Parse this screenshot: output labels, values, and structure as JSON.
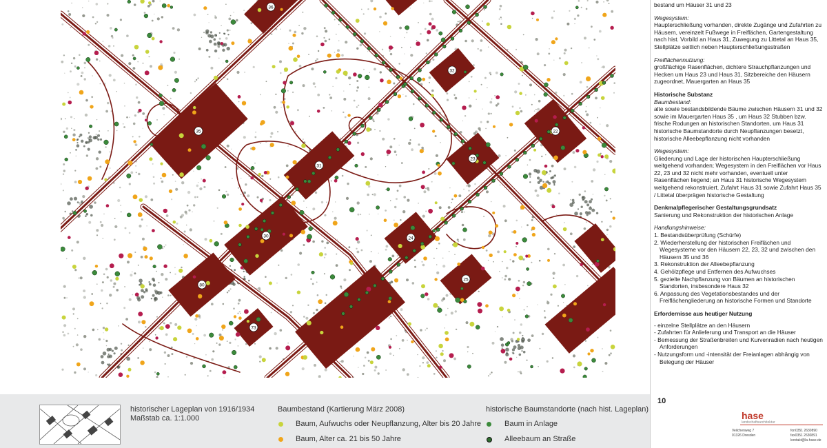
{
  "map": {
    "building_labels": [
      "36",
      "32",
      "35",
      "22",
      "31",
      "23",
      "30",
      "24",
      "80",
      "25",
      "73"
    ],
    "colors": {
      "building": "#7a1a14",
      "road": "#7a1a14",
      "tree_young": "#c8d43c",
      "tree_mid": "#f0a51a",
      "tree_old": "#b51d4e",
      "tree_hist": "#3b8a3b",
      "vegetation": "#7f8378"
    }
  },
  "side": {
    "top_cut": "bestand um Häuser 31 und 23",
    "wege1_title": "Wegesystem:",
    "wege1_text": "Haupterschließung vorhanden, direkte Zugänge und Zufahrten zu Häusern, vereinzelt Fußwege in Freiflächen, Gartengestaltung nach hist. Vorbild an Haus 31, Zuwegung zu Littetal an Haus 35, Stellplätze seitlich neben Haupterschließungsstraßen",
    "frei_title": "Freiflächennutzung:",
    "frei_text": "großflächige Rasenflächen, dichtere Strauchpflanzungen und Hecken um Haus 23 und Haus 31, Sitzbereiche den Häusern zugeordnet, Mauergarten an Haus 35",
    "hist_title": "Historische Substanz",
    "baum_title": "Baumbestand:",
    "baum_text": "alte sowie bestandsbildende Bäume zwischen Häusern 31 und 32 sowie im Mauergarten Haus 35 , um Haus 32 Stubben bzw. frische Rodungen an historischen Standorten, um Haus 31 historische Baumstandorte durch Neupflanzungen besetzt, historische Alleebepflanzung nicht vorhanden",
    "wege2_title": "Wegesystem:",
    "wege2_text": "Gliederung und Lage der historischen Haupterschließung weitgehend vorhanden; Wegesystem in den Freiflächen vor Haus 22, 23 und 32 nicht mehr vorhanden, eventuell unter Rasenflächen liegend; an Haus 31 historische Wegesystem weitgehend rekonstruiert, Zufahrt Haus 31 sowie Zufahrt Haus 35 / Littetal überprägen historische Gestaltung",
    "grund_title": "Denkmalpflegerischer Gestaltungsgrundsatz",
    "grund_text": "Sanierung und Rekonstruktion der historischen Anlage",
    "hand_title": "Handlungshinweise:",
    "hand_items": [
      "1. Bestandsüberprüfung (Schürfe)",
      "2. Wiederherstellung der historischen Freiflächen und Wegesysteme vor den Häusern 22, 23, 32 und zwischen den Häusern 35 und 36",
      "3. Rekonstruktion der Alleebepflanzung",
      "4. Gehölzpflege und Entfernen des Aufwuchses",
      "5. gezielte Nachpflanzung von Bäumen an historischen Standorten, insbesondere Haus 32",
      "6. Anpassung des Vegetationsbestandes und der Freiflächengliederung an historische Formen und Standorte"
    ],
    "erf_title": "Erfordernisse aus heutiger Nutzung",
    "erf_items": [
      "- einzelne Stellplätze an den Häusern",
      "- Zufahrten für Anlieferung und Transport an die Häuser",
      "- Bemessung der Straßenbreiten und Kurvenradien nach heutigen Anforderungen",
      "- Nutzungsform und -intensität der Freianlagen abhängig von Belegung der Häuser"
    ]
  },
  "legend": {
    "hist_plan_title": "historischer Lageplan von 1916/1934",
    "hist_plan_scale": "Maßstab ca. 1:1.000",
    "baum_title": "Baumbestand (Kartierung März 2008)",
    "baum_items": [
      {
        "label": "Baum, Aufwuchs oder Neupflanzung, Alter bis 20 Jahre",
        "color": "#c8d43c"
      },
      {
        "label": "Baum, Alter ca. 21 bis 50 Jahre",
        "color": "#f0a51a"
      }
    ],
    "hist_title": "historische Baumstandorte (nach hist. Lageplan)",
    "hist_items": [
      {
        "label": "Baum in Anlage",
        "color": "#3b8a3b"
      },
      {
        "label": "Alleebaum an Straße",
        "color": "#2f6e2f"
      }
    ]
  },
  "footer": {
    "page_number": "10",
    "logo": "hase",
    "logo_sub": "landschaftsarchitektur",
    "address_line1": "Veilchenweg 7",
    "address_line2": "01326 Dresden",
    "phone": "fon0351 2630890",
    "fax": "fax0351 2630891",
    "email": "kontakt@la-hase.de"
  }
}
